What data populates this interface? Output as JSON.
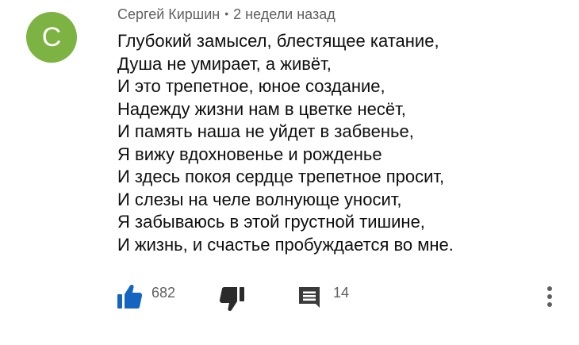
{
  "comment": {
    "avatar_letter": "С",
    "avatar_color": "#7cb342",
    "author": "Сергей Киршин",
    "separator": "•",
    "time": "2 недели назад",
    "lines": [
      "Глубокий замысел, блестящее катание,",
      "Душа не умирает, а живёт,",
      "И это трепетное, юное создание,",
      "Надежду жизни нам в цветке несёт,",
      "И память наша не уйдет в забвенье,",
      "Я вижу вдохновенье и рожденье",
      "И здесь покоя сердце трепетное просит,",
      "И слезы на челе волнующе уносит,",
      "Я забываюсь в этой грустной тишине,",
      "И жизнь, и счастье пробуждается во мне."
    ]
  },
  "actions": {
    "like_icon": "thumbs-up-icon",
    "like_count": "682",
    "like_color": "#1565c0",
    "dislike_icon": "thumbs-down-icon",
    "reply_icon": "comment-icon",
    "reply_count": "14",
    "menu_icon": "more-vertical-icon"
  }
}
